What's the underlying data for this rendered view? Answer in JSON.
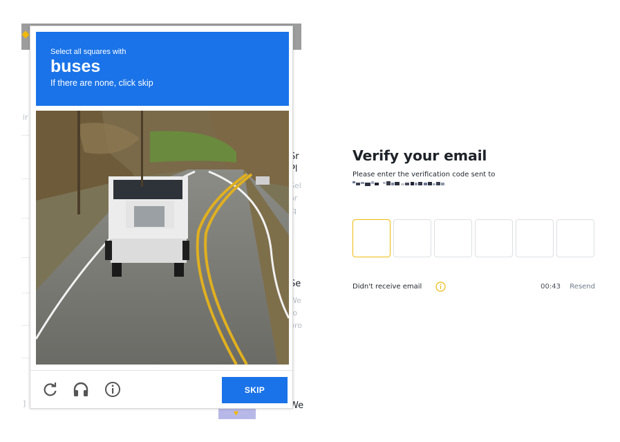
{
  "captcha": {
    "instruction": "Select all squares with",
    "target": "buses",
    "hint": "If there are none, click skip",
    "rows": 4,
    "cols": 4,
    "skip_label": "SKIP",
    "icons": [
      "reload-icon",
      "headphones-icon",
      "info-icon"
    ],
    "accent_color": "#1a73e8"
  },
  "verify": {
    "title": "Verify your email",
    "subtitle": "Please enter the verification code sent to",
    "code_digits": [
      "",
      "",
      "",
      "",
      "",
      ""
    ],
    "didnt_receive": "Didn't receive email",
    "timer": "00:43",
    "resend": "Resend",
    "active_color": "#f0b90b"
  }
}
